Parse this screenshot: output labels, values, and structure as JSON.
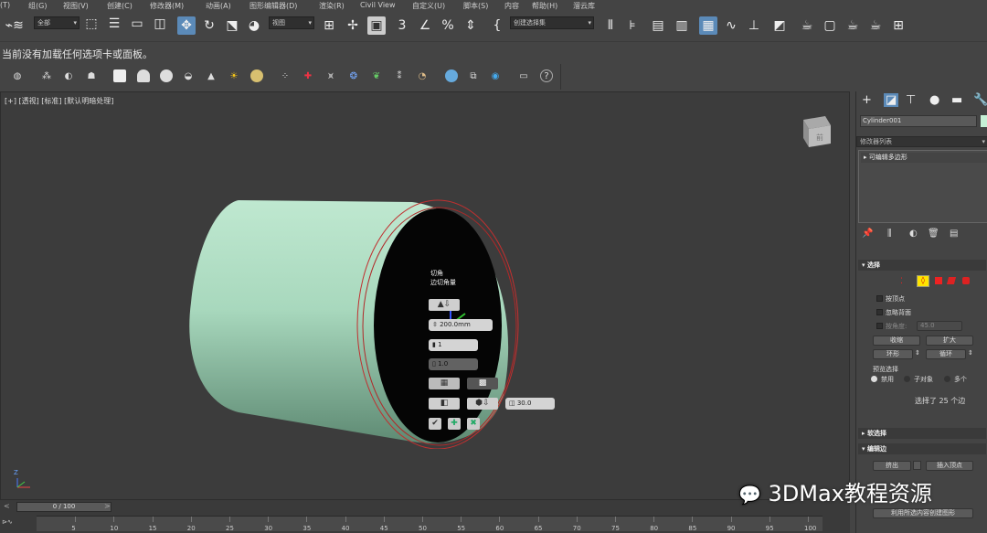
{
  "menubar": {
    "items": [
      "(T)",
      "组(G)",
      "视图(V)",
      "创建(C)",
      "修改器(M)",
      "动画(A)",
      "图形编辑器(D)",
      "渲染(R)",
      "Civil View",
      "自定义(U)",
      "脚本(S)",
      "内容",
      "帮助(H)",
      "溜云库"
    ]
  },
  "toolbar": {
    "selection_filter": "全部",
    "ref_coord": "视图",
    "named_selection": "创建选择集"
  },
  "infobar": {
    "message": "当前没有加载任何选项卡或面板。"
  },
  "viewport": {
    "labels": [
      "[+]",
      "[透视]",
      "[标准]",
      "[默认明暗处理]"
    ],
    "navcube_label": "前",
    "caddy": {
      "title": "切角",
      "subtitle": "边切角量",
      "amount": "200.0mm",
      "segments": "1",
      "tension": "1.0",
      "smooth_angle": "30.0"
    },
    "axis_label": "Z"
  },
  "command_panel": {
    "object_name": "Cylinder001",
    "object_color": "#c6f0d6",
    "modifier_list": "修改器列表",
    "stack_item": "可编辑多边形",
    "selection": {
      "header": "选择",
      "by_vertex": "按顶点",
      "ignore_backfacing": "忽略背面",
      "by_angle": "按角度:",
      "angle": "45.0",
      "shrink": "收缩",
      "grow": "扩大",
      "ring": "环形",
      "loop": "循环",
      "preview_header": "预览选择",
      "preview_off": "禁用",
      "preview_subobj": "子对象",
      "preview_multi": "多个",
      "status": "选择了 25 个边"
    },
    "soft_selection": "软选择",
    "edit_edges": {
      "header": "编辑边",
      "extrude": "挤出",
      "insert_vertex": "插入顶点",
      "create_shape": "利用所选内容创建图形"
    }
  },
  "timeline": {
    "slider": "0 / 100",
    "ticks": [
      "5",
      "10",
      "15",
      "20",
      "25",
      "30",
      "35",
      "40",
      "45",
      "50",
      "55",
      "60",
      "65",
      "70",
      "75",
      "80",
      "85",
      "90",
      "95",
      "100"
    ]
  },
  "watermark": "3DMax教程资源"
}
